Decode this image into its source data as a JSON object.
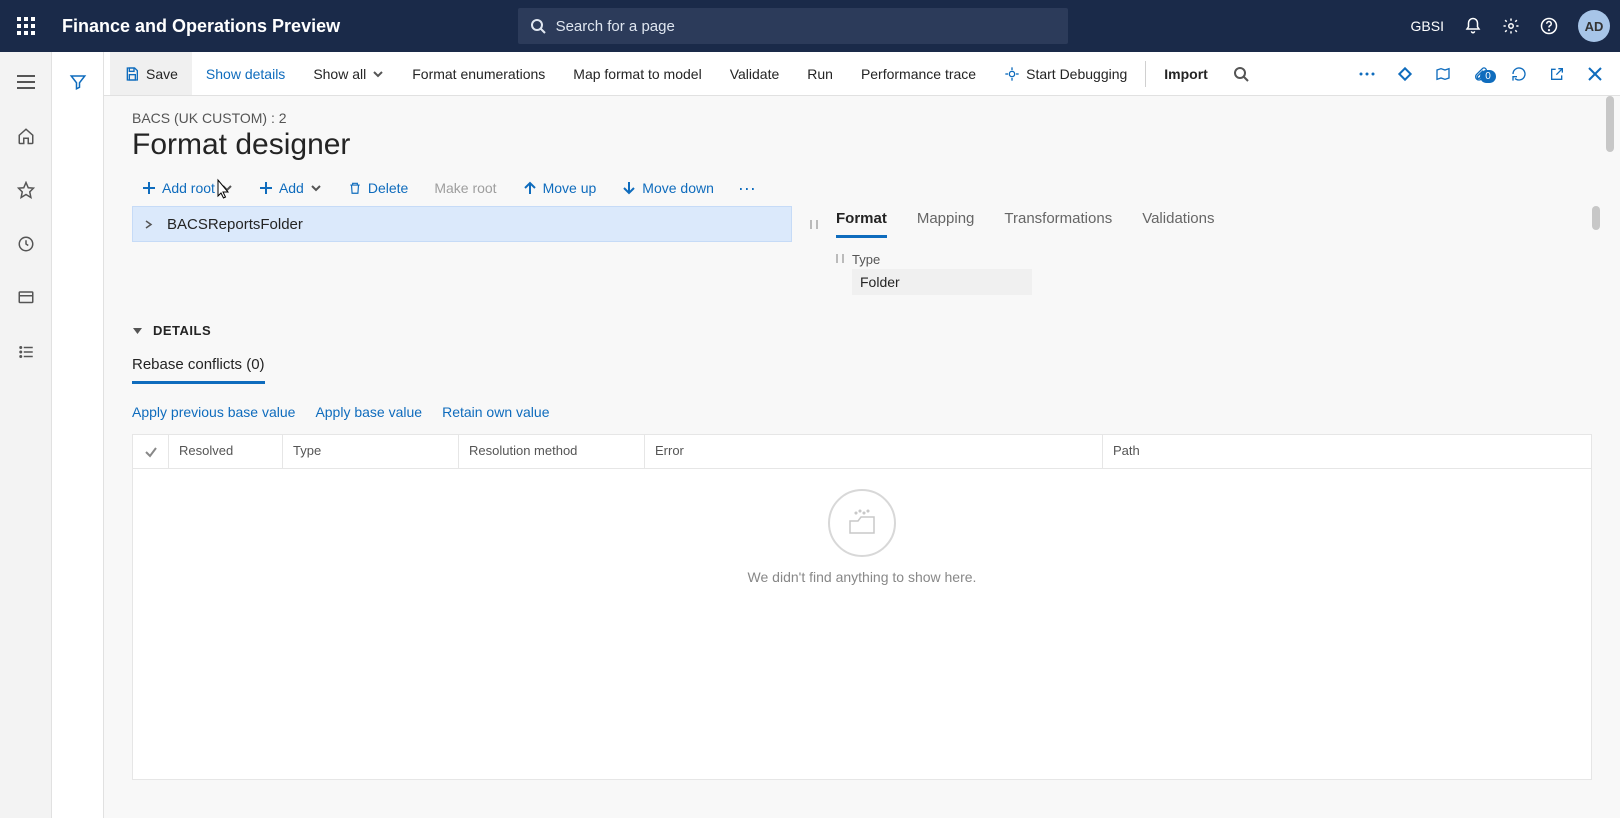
{
  "header": {
    "app_title": "Finance and Operations Preview",
    "search_placeholder": "Search for a page",
    "company": "GBSI",
    "avatar_initials": "AD"
  },
  "actionbar": {
    "save": "Save",
    "show_details": "Show details",
    "show_all": "Show all",
    "format_enums": "Format enumerations",
    "map_format": "Map format to model",
    "validate": "Validate",
    "run": "Run",
    "perf_trace": "Performance trace",
    "start_debug": "Start Debugging",
    "import": "Import",
    "badge_count": "0"
  },
  "page": {
    "breadcrumb": "BACS (UK CUSTOM) : 2",
    "title": "Format designer"
  },
  "toolbar2": {
    "add_root": "Add root",
    "add": "Add",
    "delete": "Delete",
    "make_root": "Make root",
    "move_up": "Move up",
    "move_down": "Move down"
  },
  "tree": {
    "items": [
      {
        "label": "BACSReportsFolder"
      }
    ]
  },
  "tabs": {
    "items": [
      {
        "label": "Format",
        "active": true
      },
      {
        "label": "Mapping"
      },
      {
        "label": "Transformations"
      },
      {
        "label": "Validations"
      }
    ]
  },
  "properties": {
    "type_label": "Type",
    "type_value": "Folder"
  },
  "details": {
    "heading": "DETAILS",
    "subtab": "Rebase conflicts (0)",
    "apply_prev": "Apply previous base value",
    "apply_base": "Apply base value",
    "retain_own": "Retain own value"
  },
  "grid": {
    "columns": {
      "resolved": "Resolved",
      "type": "Type",
      "resolution_method": "Resolution method",
      "error": "Error",
      "path": "Path"
    },
    "empty_message": "We didn't find anything to show here."
  }
}
